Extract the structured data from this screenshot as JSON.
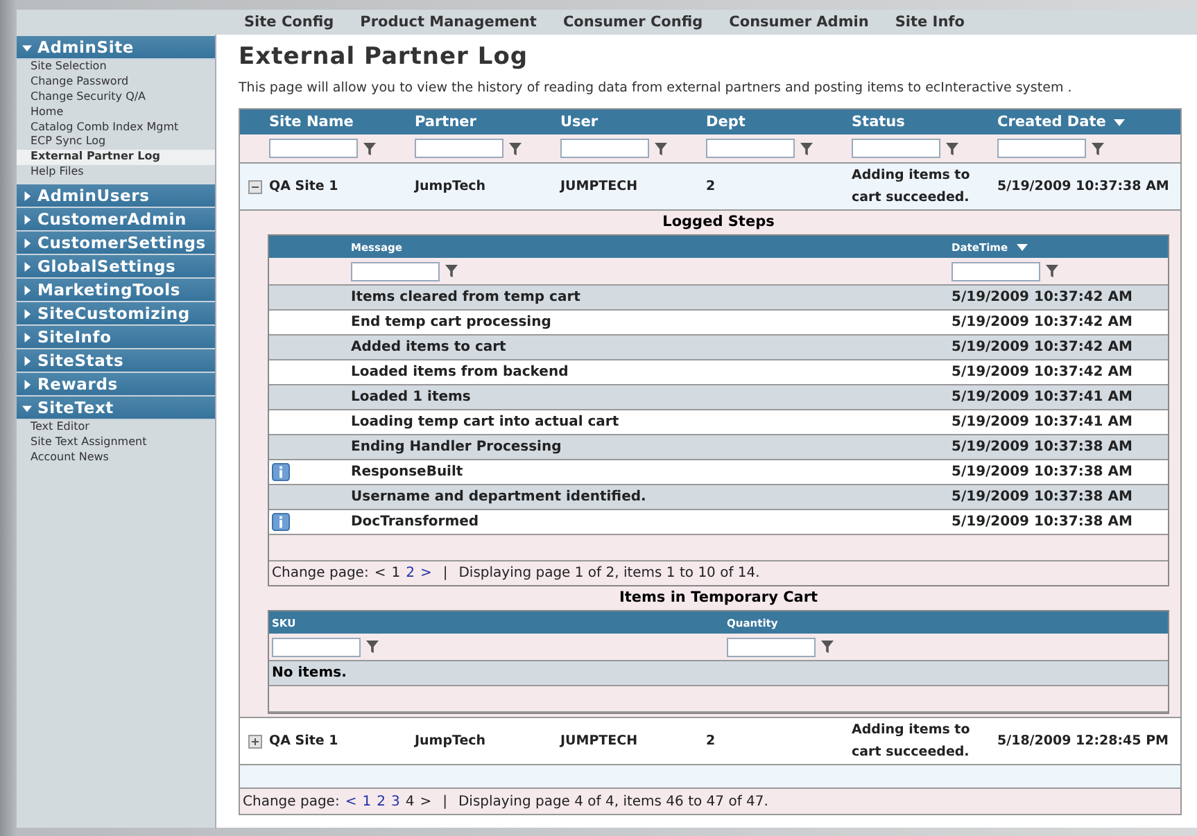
{
  "top_nav": [
    "Site Config",
    "Product Management",
    "Consumer Config",
    "Consumer Admin",
    "Site Info"
  ],
  "sidebar": [
    {
      "label": "AdminSite",
      "expanded": true,
      "items": [
        {
          "label": "Site Selection",
          "selected": false
        },
        {
          "label": "Change Password",
          "selected": false
        },
        {
          "label": "Change Security Q/A",
          "selected": false
        },
        {
          "label": "Home",
          "selected": false
        },
        {
          "label": "Catalog Comb Index Mgmt",
          "selected": false
        },
        {
          "label": "ECP Sync Log",
          "selected": false
        },
        {
          "label": "External Partner Log",
          "selected": true
        },
        {
          "label": "Help Files",
          "selected": false
        }
      ]
    },
    {
      "label": "AdminUsers",
      "expanded": false
    },
    {
      "label": "CustomerAdmin",
      "expanded": false
    },
    {
      "label": "CustomerSettings",
      "expanded": false
    },
    {
      "label": "GlobalSettings",
      "expanded": false
    },
    {
      "label": "MarketingTools",
      "expanded": false
    },
    {
      "label": "SiteCustomizing",
      "expanded": false
    },
    {
      "label": "SiteInfo",
      "expanded": false
    },
    {
      "label": "SiteStats",
      "expanded": false
    },
    {
      "label": "Rewards",
      "expanded": false
    },
    {
      "label": "SiteText",
      "expanded": true,
      "items": [
        {
          "label": "Text Editor",
          "selected": false
        },
        {
          "label": "Site Text Assignment",
          "selected": false
        },
        {
          "label": "Account News",
          "selected": false
        }
      ]
    }
  ],
  "page": {
    "title": "External Partner Log",
    "description": "This page will allow you to view the history of reading data from external partners and posting items to ecInteractive system ."
  },
  "table": {
    "columns": [
      {
        "label": "Site Name",
        "sorted": false
      },
      {
        "label": "Partner",
        "sorted": false
      },
      {
        "label": "User",
        "sorted": false
      },
      {
        "label": "Dept",
        "sorted": false
      },
      {
        "label": "Status",
        "sorted": false
      },
      {
        "label": "Created Date",
        "sorted": true
      }
    ],
    "rows": [
      {
        "expanded": true,
        "cells": [
          "QA Site 1",
          "JumpTech",
          "JUMPTECH",
          "2",
          "Adding items to cart succeeded.",
          "5/19/2009 10:37:38 AM"
        ],
        "detail": {
          "steps_title": "Logged Steps",
          "steps_columns": [
            {
              "label": "Message",
              "sorted": false
            },
            {
              "label": "DateTime",
              "sorted": true
            }
          ],
          "steps": [
            {
              "info": false,
              "message": "Items cleared from temp cart",
              "datetime": "5/19/2009 10:37:42 AM"
            },
            {
              "info": false,
              "message": "End temp cart processing",
              "datetime": "5/19/2009 10:37:42 AM"
            },
            {
              "info": false,
              "message": "Added items to cart",
              "datetime": "5/19/2009 10:37:42 AM"
            },
            {
              "info": false,
              "message": "Loaded items from backend",
              "datetime": "5/19/2009 10:37:42 AM"
            },
            {
              "info": false,
              "message": "Loaded 1 items",
              "datetime": "5/19/2009 10:37:41 AM"
            },
            {
              "info": false,
              "message": "Loading temp cart into actual cart",
              "datetime": "5/19/2009 10:37:41 AM"
            },
            {
              "info": false,
              "message": "Ending Handler Processing",
              "datetime": "5/19/2009 10:37:38 AM"
            },
            {
              "info": true,
              "message": "ResponseBuilt",
              "datetime": "5/19/2009 10:37:38 AM"
            },
            {
              "info": false,
              "message": "Username and department identified.",
              "datetime": "5/19/2009 10:37:38 AM"
            },
            {
              "info": true,
              "message": "DocTransformed",
              "datetime": "5/19/2009 10:37:38 AM"
            }
          ],
          "steps_pager": {
            "label": "Change page:",
            "pages": [
              {
                "text": "<",
                "link": false
              },
              {
                "text": "1",
                "link": false
              },
              {
                "text": "2",
                "link": true
              },
              {
                "text": ">",
                "link": true
              }
            ],
            "separator": "|",
            "summary": "Displaying page 1 of 2, items 1 to 10 of 14."
          },
          "cart_title": "Items in Temporary Cart",
          "cart_columns": [
            "SKU",
            "Quantity"
          ],
          "cart_empty": "No items."
        }
      },
      {
        "expanded": false,
        "cells": [
          "QA Site 1",
          "JumpTech",
          "JUMPTECH",
          "2",
          "Adding items to cart succeeded.",
          "5/18/2009 12:28:45 PM"
        ]
      }
    ],
    "pager": {
      "label": "Change page:",
      "pages": [
        {
          "text": "<",
          "link": true
        },
        {
          "text": "1",
          "link": true
        },
        {
          "text": "2",
          "link": true
        },
        {
          "text": "3",
          "link": true
        },
        {
          "text": "4",
          "link": false
        },
        {
          "text": ">",
          "link": false
        }
      ],
      "separator": "|",
      "summary": "Displaying page 4 of 4, items 46 to 47 of 47."
    }
  }
}
